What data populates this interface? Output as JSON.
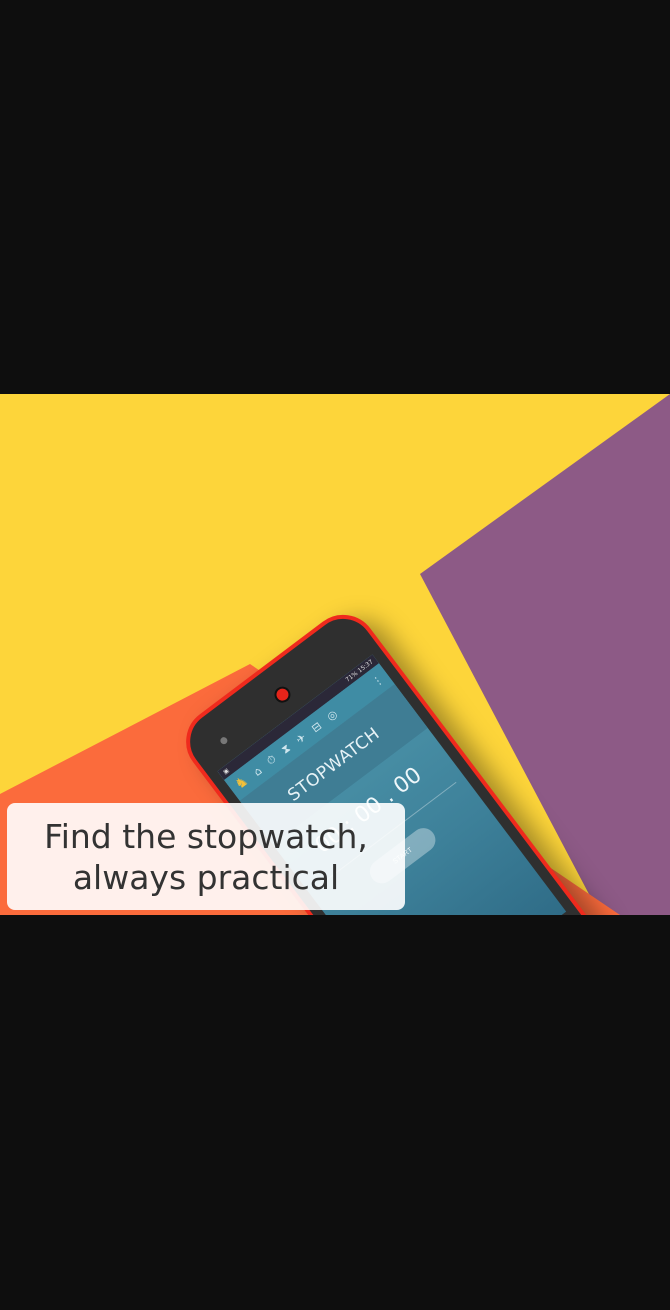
{
  "caption": {
    "line1": "Find the stopwatch,",
    "line2": "always practical"
  },
  "phone": {
    "status": {
      "battery": "71%",
      "time": "15:37"
    },
    "nav_icons": [
      "app-logo-icon",
      "home-icon",
      "stopwatch-icon",
      "hourglass-icon",
      "airplane-icon",
      "bed-icon",
      "globe-icon",
      "more-icon"
    ],
    "title": "STOPWATCH",
    "time": "00 : 00 . 00",
    "start_label": "START"
  },
  "colors": {
    "frame": "#ef2a1d",
    "screen": "#3f8ca4",
    "yellow": "#fdd53a",
    "purple": "#8d5a86",
    "orange": "#fb6b3c"
  }
}
